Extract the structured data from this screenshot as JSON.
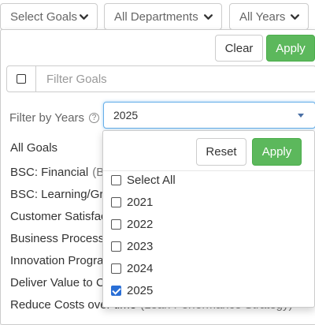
{
  "toolbar": {
    "goals_label": "Select Goals",
    "departments_label": "All Departments",
    "years_label": "All Years"
  },
  "goals_panel": {
    "clear_label": "Clear",
    "apply_label": "Apply",
    "filter_placeholder": "Filter Goals",
    "years_filter_label": "Filter by Years",
    "help_glyph": "?",
    "years_selected": "2025",
    "goals": [
      {
        "name": "All Goals",
        "detail": ""
      },
      {
        "name": "BSC: Financial",
        "detail": "(B"
      },
      {
        "name": "BSC: Learning/Gro",
        "detail": ""
      },
      {
        "name": "Customer Satisfact",
        "detail": ""
      },
      {
        "name": "Business Process",
        "detail": ""
      },
      {
        "name": "Innovation Prograr",
        "detail": ""
      },
      {
        "name": "Deliver Value to Cu",
        "detail": ""
      },
      {
        "name": "Reduce Costs over time",
        "detail": "(Lean Performance Strategy)"
      }
    ]
  },
  "years_dropdown": {
    "reset_label": "Reset",
    "apply_label": "Apply",
    "options": [
      {
        "label": "Select All",
        "checked": false
      },
      {
        "label": "2021",
        "checked": false
      },
      {
        "label": "2022",
        "checked": false
      },
      {
        "label": "2023",
        "checked": false
      },
      {
        "label": "2024",
        "checked": false
      },
      {
        "label": "2025",
        "checked": true
      }
    ]
  },
  "colors": {
    "primary": "#5cb85c",
    "focus_border": "#66afe9",
    "checkbox_checked": "#2a6fd6"
  }
}
